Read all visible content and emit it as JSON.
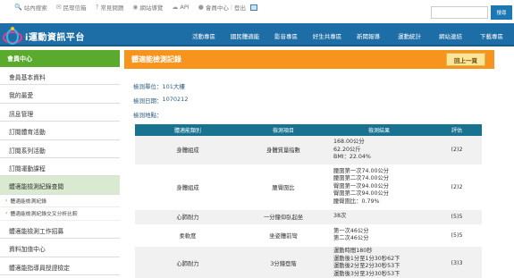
{
  "topbar": {
    "links": [
      "站內搜索",
      "民眾信箱",
      "常見問題",
      "網站導覽",
      "API"
    ],
    "member_prefix": "會員中心",
    "logout": "登出",
    "search_placeholder": "",
    "search_button": "搜尋"
  },
  "brand": {
    "logo_text": "i運動資訊平台",
    "accent_blue": "#1d6ea6",
    "accent_green": "#5aaa2d",
    "accent_orange": "#f7941d"
  },
  "nav": {
    "items": [
      "活動專區",
      "國民體適能",
      "影音專區",
      "好生共專區",
      "新聞報導",
      "運動統計",
      "網站連結",
      "下載專區"
    ]
  },
  "sidebar": {
    "header": "會員中心",
    "items": [
      "會員基本資料",
      "我的最愛",
      "訊息管理",
      "訂閱體育活動",
      "訂閱系列活動",
      "訂閱運動課程",
      "體適能檢測紀錄查閱"
    ],
    "subitems": [
      "體適能檢測紀錄",
      "體適能檢測紀錄交叉分析比較"
    ],
    "items_after": [
      "體適能檢測工作招募",
      "資料加值中心",
      "體適能指導員授證檢定"
    ]
  },
  "content": {
    "title": "體適能檢測記錄",
    "back_button": "回上一頁",
    "info": [
      {
        "label": "檢測單位：",
        "value": "101大樓"
      },
      {
        "label": "檢測日期：",
        "value": "1070212"
      },
      {
        "label": "檢測地點：",
        "value": ""
      }
    ]
  },
  "table": {
    "headers": [
      "體適能類別",
      "檢測項目",
      "檢測結果",
      "評估"
    ],
    "rows": [
      {
        "category": "身體組成",
        "item": "身體質量指數",
        "results": [
          "168.00公分",
          "62.20公斤",
          "BMI：22.04%"
        ],
        "eval": "(2)2"
      },
      {
        "category": "身體組成",
        "item": "腰臀圍比",
        "results": [
          "腰圍第一次74.00公分",
          "腰圍第二次74.00公分",
          "臀圍第一次94.00公分",
          "臀圍第二次94.00公分",
          "腰臀圍比：0.79%"
        ],
        "eval": "(2)2"
      },
      {
        "category": "心肺耐力",
        "item": "一分鐘仰臥起坐",
        "results": [
          "38次"
        ],
        "eval": "(5)5"
      },
      {
        "category": "柔軟度",
        "item": "坐姿體前彎",
        "results": [
          "第一次46公分",
          "第二次46公分"
        ],
        "eval": "(5)5"
      },
      {
        "category": "心肺耐力",
        "item": "3分鐘登階",
        "results": [
          "運動時間180秒",
          "運動後1分至1分30秒62下",
          "運動後2分至2分30秒53下",
          "運動後3分至3分30秒53下"
        ],
        "eval": "(3)3"
      }
    ]
  }
}
